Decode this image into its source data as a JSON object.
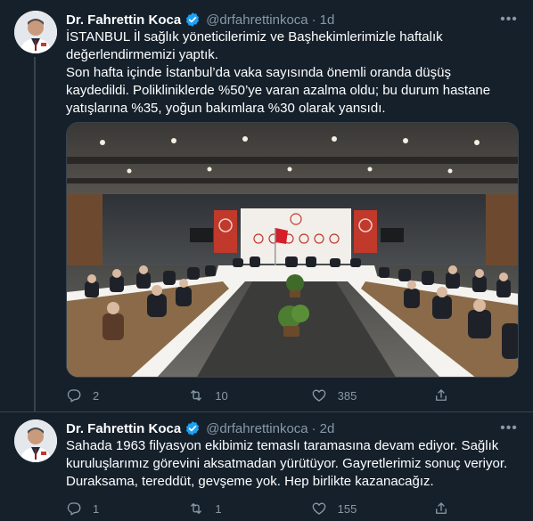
{
  "colors": {
    "background": "#15202b",
    "text": "#ffffff",
    "secondary": "#8899a6",
    "verified": "#1da1f2",
    "divider": "#38444d"
  },
  "tweets": [
    {
      "author": {
        "name": "Dr. Fahrettin Koca",
        "handle": "@drfahrettinkoca",
        "verified": true
      },
      "time": "1d",
      "dot": "·",
      "text_lines": [
        "İSTANBUL İl sağlık yöneticilerimiz ve Başhekimlerimizle haftalık değerlendirmemizi yaptık.",
        "Son hafta içinde İstanbul’da vaka sayısında önemli oranda düşüş kaydedildi. Polikliniklerde %50’ye  varan azalma oldu; bu durum hastane yatışlarına %35, yoğun bakımlara %30 olarak yansıdı."
      ],
      "media": {
        "type": "photo"
      },
      "counts": {
        "replies": "2",
        "retweets": "10",
        "likes": "385"
      },
      "icons": [
        "reply-icon",
        "retweet-icon",
        "like-icon",
        "share-icon",
        "more-icon",
        "verified-icon"
      ]
    },
    {
      "author": {
        "name": "Dr. Fahrettin Koca",
        "handle": "@drfahrettinkoca",
        "verified": true
      },
      "time": "2d",
      "dot": "·",
      "text_lines": [
        "Sahada 1963 filyasyon ekibimiz temaslı taramasına devam ediyor. Sağlık kuruluşlarımız görevini aksatmadan yürütüyor. Gayretlerimiz sonuç veriyor. Duraksama, tereddüt, gevşeme yok. Hep birlikte kazanacağız."
      ],
      "counts": {
        "replies": "1",
        "retweets": "1",
        "likes": "155"
      }
    }
  ]
}
